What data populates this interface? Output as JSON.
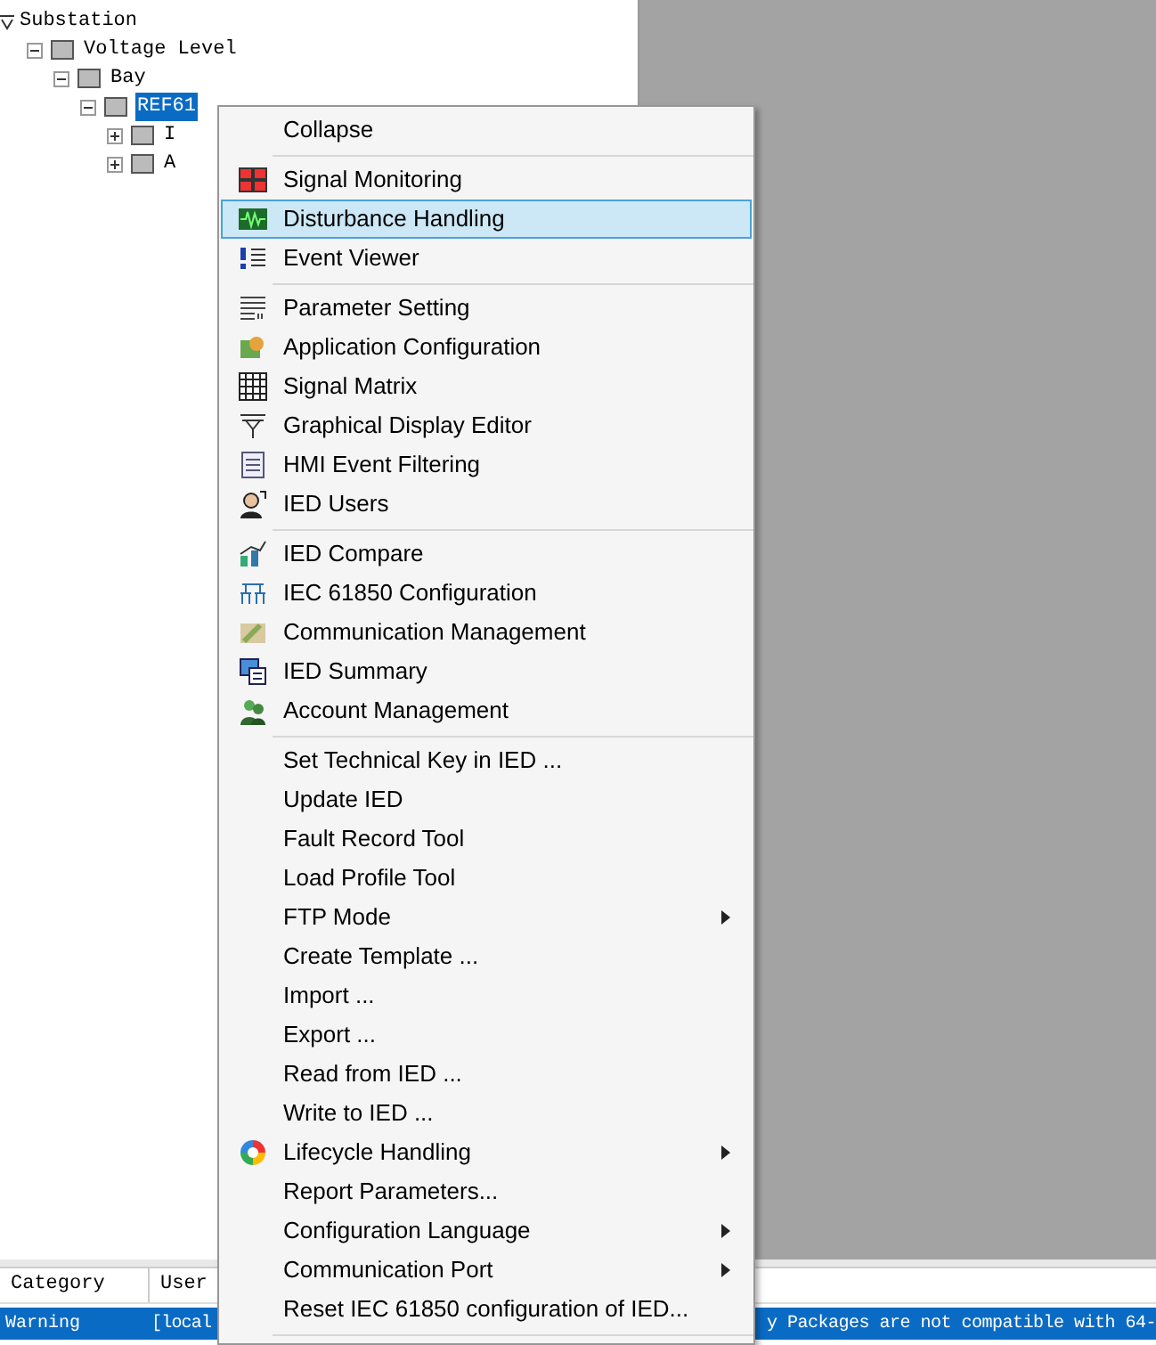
{
  "tree": [
    {
      "label": "Substation",
      "expanded": true,
      "children": [
        {
          "label": "Voltage Level",
          "expanded": true,
          "children": [
            {
              "label": "Bay",
              "expanded": true,
              "children": [
                {
                  "label": "REF61",
                  "expanded": true,
                  "selected": true,
                  "children": [
                    {
                      "label": "I",
                      "expanded": false,
                      "selected": false
                    },
                    {
                      "label": "A",
                      "expanded": false,
                      "selected": false
                    }
                  ]
                }
              ]
            }
          ]
        }
      ]
    }
  ],
  "log": {
    "columns": [
      "Category",
      "User"
    ],
    "rows": [
      {
        "selected": true,
        "cells": [
          "Warning",
          "[local",
          "y Packages are not compatible with 64-"
        ]
      }
    ]
  },
  "context_menu": [
    {
      "kind": "item",
      "label": "Collapse",
      "selected": false,
      "submenu": false
    },
    {
      "kind": "separator"
    },
    {
      "kind": "item",
      "label": "Signal Monitoring",
      "selected": false,
      "submenu": false
    },
    {
      "kind": "item",
      "label": "Disturbance Handling",
      "selected": true,
      "submenu": false
    },
    {
      "kind": "item",
      "label": "Event Viewer",
      "selected": false,
      "submenu": false
    },
    {
      "kind": "separator"
    },
    {
      "kind": "item",
      "label": "Parameter Setting",
      "selected": false,
      "submenu": false
    },
    {
      "kind": "item",
      "label": "Application Configuration",
      "selected": false,
      "submenu": false
    },
    {
      "kind": "item",
      "label": "Signal Matrix",
      "selected": false,
      "submenu": false
    },
    {
      "kind": "item",
      "label": "Graphical Display Editor",
      "selected": false,
      "submenu": false
    },
    {
      "kind": "item",
      "label": "HMI Event Filtering",
      "selected": false,
      "submenu": false
    },
    {
      "kind": "item",
      "label": "IED Users",
      "selected": false,
      "submenu": false
    },
    {
      "kind": "separator"
    },
    {
      "kind": "item",
      "label": "IED Compare",
      "selected": false,
      "submenu": false
    },
    {
      "kind": "item",
      "label": "IEC 61850 Configuration",
      "selected": false,
      "submenu": false
    },
    {
      "kind": "item",
      "label": "Communication Management",
      "selected": false,
      "submenu": false
    },
    {
      "kind": "item",
      "label": "IED Summary",
      "selected": false,
      "submenu": false
    },
    {
      "kind": "item",
      "label": "Account Management",
      "selected": false,
      "submenu": false
    },
    {
      "kind": "separator"
    },
    {
      "kind": "item",
      "label": "Set Technical Key in IED ...",
      "selected": false,
      "submenu": false
    },
    {
      "kind": "item",
      "label": "Update IED",
      "selected": false,
      "submenu": false
    },
    {
      "kind": "item",
      "label": "Fault Record Tool",
      "selected": false,
      "submenu": false
    },
    {
      "kind": "item",
      "label": "Load Profile Tool",
      "selected": false,
      "submenu": false
    },
    {
      "kind": "item",
      "label": "FTP Mode",
      "selected": false,
      "submenu": true
    },
    {
      "kind": "item",
      "label": "Create Template ...",
      "selected": false,
      "submenu": false
    },
    {
      "kind": "item",
      "label": "Import ...",
      "selected": false,
      "submenu": false
    },
    {
      "kind": "item",
      "label": "Export ...",
      "selected": false,
      "submenu": false
    },
    {
      "kind": "item",
      "label": "Read from IED ...",
      "selected": false,
      "submenu": false
    },
    {
      "kind": "item",
      "label": "Write to IED ...",
      "selected": false,
      "submenu": false
    },
    {
      "kind": "item",
      "label": "Lifecycle Handling",
      "selected": false,
      "submenu": true
    },
    {
      "kind": "item",
      "label": "Report Parameters...",
      "selected": false,
      "submenu": false
    },
    {
      "kind": "item",
      "label": "Configuration Language",
      "selected": false,
      "submenu": true
    },
    {
      "kind": "item",
      "label": "Communication Port",
      "selected": false,
      "submenu": true
    },
    {
      "kind": "item",
      "label": "Reset IEC 61850 configuration of IED...",
      "selected": false,
      "submenu": false
    },
    {
      "kind": "separator"
    }
  ]
}
